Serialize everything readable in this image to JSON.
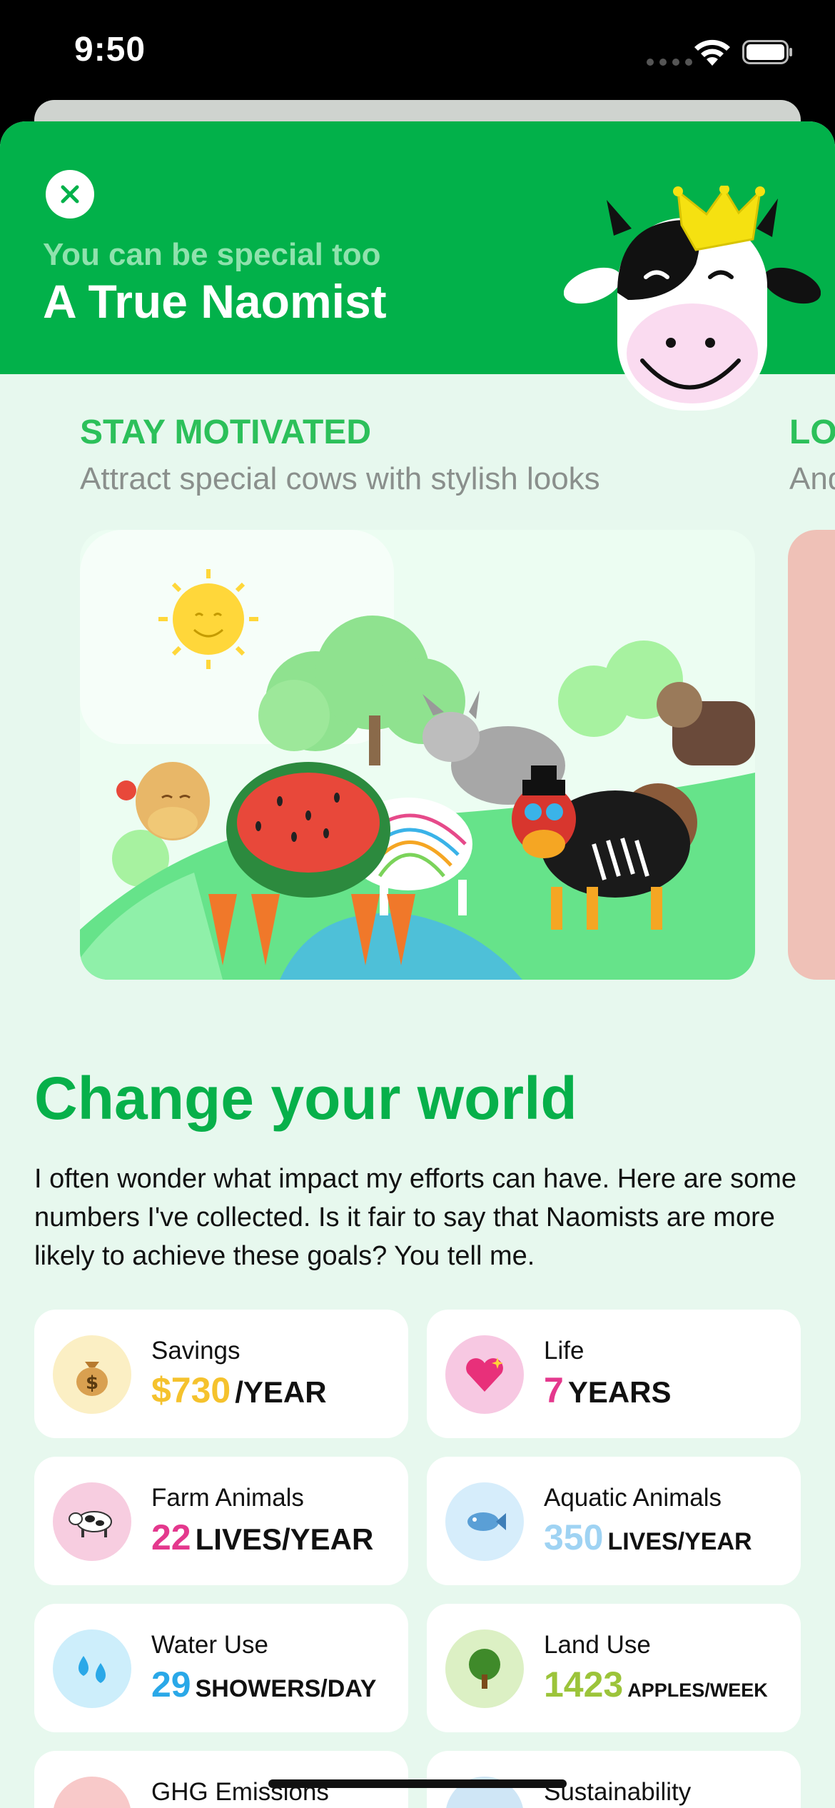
{
  "status_bar": {
    "time": "9:50"
  },
  "header": {
    "subtitle": "You can be special too",
    "title": "A True Naomist"
  },
  "carousel": {
    "current": {
      "heading": "STAY MOTIVATED",
      "description": "Attract special cows with stylish looks"
    },
    "next_peek": {
      "heading": "LO",
      "description": "And"
    }
  },
  "impact": {
    "heading": "Change your world",
    "paragraph": "I often wonder what impact my efforts can have. Here are some numbers I've collected. Is it fair to say that Naomists are more likely to achieve these goals? You tell me.",
    "stats": [
      {
        "icon": "money-bag-icon",
        "label": "Savings",
        "value": "$730",
        "unit": "/YEAR",
        "color": "#f5c22d",
        "bg": "#fbefc4"
      },
      {
        "icon": "sparkling-heart-icon",
        "label": "Life",
        "value": "7",
        "unit": "YEARS",
        "color": "#e4388d",
        "bg": "#f7c8e2"
      },
      {
        "icon": "cow-icon",
        "label": "Farm Animals",
        "value": "22",
        "unit": "LIVES/YEAR",
        "color": "#e4388d",
        "bg": "#f7cde0"
      },
      {
        "icon": "fish-icon",
        "label": "Aquatic Animals",
        "value": "350",
        "unit": "LIVES/YEAR",
        "color": "#9fd3f3",
        "bg": "#d6edfb"
      },
      {
        "icon": "droplets-icon",
        "label": "Water Use",
        "value": "29",
        "unit": "SHOWERS/DAY",
        "color": "#2aa8e8",
        "bg": "#cdeefb"
      },
      {
        "icon": "tree-icon",
        "label": "Land Use",
        "value": "1423",
        "unit": "APPLES/WEEK",
        "color": "#9cc43a",
        "bg": "#dcf0c4"
      },
      {
        "icon": "cloud-icon",
        "label": "GHG Emissions",
        "value": "",
        "unit": "",
        "color": "#e06a6a",
        "bg": "#f8c9c9"
      },
      {
        "icon": "globe-icon",
        "label": "Sustainability",
        "value": "",
        "unit": "",
        "color": "#4aa3d8",
        "bg": "#cfe6f6"
      }
    ]
  }
}
